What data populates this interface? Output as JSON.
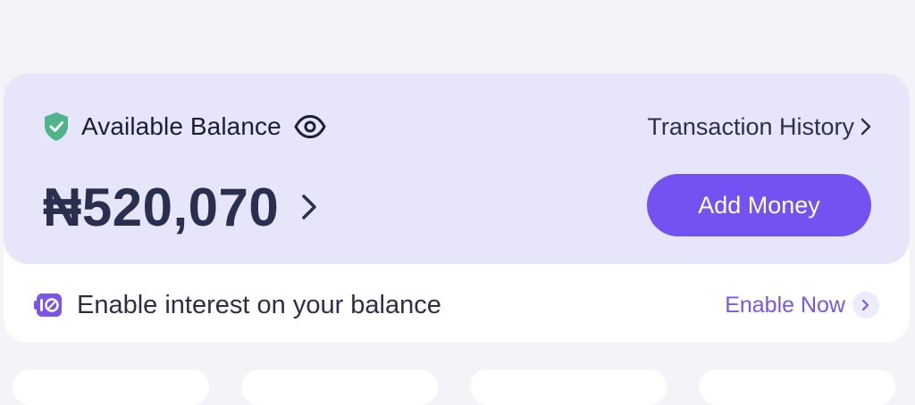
{
  "balance_card": {
    "label": "Available Balance",
    "transaction_history": "Transaction History",
    "amount": "₦520,070",
    "add_money": "Add Money"
  },
  "interest_banner": {
    "text": "Enable interest on your balance",
    "action": "Enable Now"
  },
  "colors": {
    "accent": "#7451f0",
    "panel": "#e6e5fa",
    "shield": "#4fb48a",
    "link": "#7a55e8"
  },
  "icons": [
    "shield-check-icon",
    "eye-icon",
    "chevron-right-icon",
    "interest-icon"
  ]
}
